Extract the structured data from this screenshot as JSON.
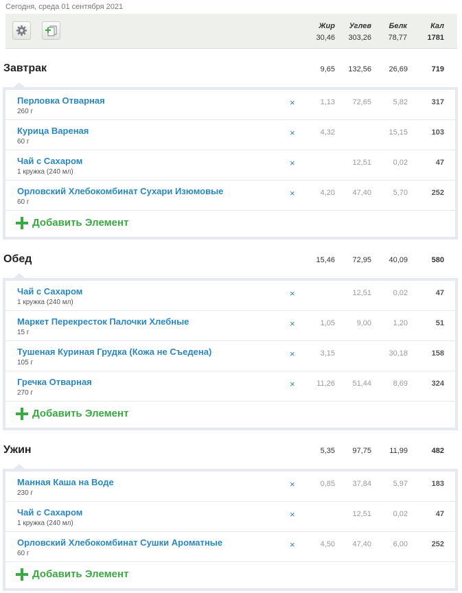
{
  "date_text": "Сегодня, среда 01 сентября 2021",
  "toolbar": {
    "settings_icon": "gear-icon",
    "add_copy_icon": "add-copy-icon"
  },
  "totals": {
    "fat_label": "Жир",
    "carbs_label": "Углев",
    "protein_label": "Белк",
    "cal_label": "Кал",
    "fat": "30,46",
    "carbs": "303,26",
    "protein": "78,77",
    "cal": "1781"
  },
  "add_label": "Добавить Элемент",
  "delete_glyph": "×",
  "meals": [
    {
      "name": "Завтрак",
      "fat": "9,65",
      "carbs": "132,56",
      "protein": "26,69",
      "cal": "719",
      "items": [
        {
          "name": "Перловка Отварная",
          "qty": "260 г",
          "fat": "1,13",
          "carbs": "72,65",
          "protein": "5,82",
          "cal": "317"
        },
        {
          "name": "Курица Вареная",
          "qty": "60 г",
          "fat": "4,32",
          "carbs": "",
          "protein": "15,15",
          "cal": "103"
        },
        {
          "name": "Чай с Сахаром",
          "qty": "1 кружка (240 мл)",
          "fat": "",
          "carbs": "12,51",
          "protein": "0,02",
          "cal": "47"
        },
        {
          "name": "Орловский Хлебокомбинат Сухари Изюмовые",
          "qty": "60 г",
          "fat": "4,20",
          "carbs": "47,40",
          "protein": "5,70",
          "cal": "252"
        }
      ]
    },
    {
      "name": "Обед",
      "fat": "15,46",
      "carbs": "72,95",
      "protein": "40,09",
      "cal": "580",
      "items": [
        {
          "name": "Чай с Сахаром",
          "qty": "1 кружка (240 мл)",
          "fat": "",
          "carbs": "12,51",
          "protein": "0,02",
          "cal": "47"
        },
        {
          "name": "Маркет Перекресток Палочки Хлебные",
          "qty": "15 г",
          "fat": "1,05",
          "carbs": "9,00",
          "protein": "1,20",
          "cal": "51"
        },
        {
          "name": "Тушеная Куриная Грудка (Кожа не Съедена)",
          "qty": "105 г",
          "fat": "3,15",
          "carbs": "",
          "protein": "30,18",
          "cal": "158"
        },
        {
          "name": "Гречка Отварная",
          "qty": "270 г",
          "fat": "11,26",
          "carbs": "51,44",
          "protein": "8,69",
          "cal": "324"
        }
      ]
    },
    {
      "name": "Ужин",
      "fat": "5,35",
      "carbs": "97,75",
      "protein": "11,99",
      "cal": "482",
      "items": [
        {
          "name": "Манная Каша на Воде",
          "qty": "230 г",
          "fat": "0,85",
          "carbs": "37,84",
          "protein": "5,97",
          "cal": "183"
        },
        {
          "name": "Чай с Сахаром",
          "qty": "1 кружка (240 мл)",
          "fat": "",
          "carbs": "12,51",
          "protein": "0,02",
          "cal": "47"
        },
        {
          "name": "Орловский Хлебокомбинат Сушки Ароматные",
          "qty": "60 г",
          "fat": "4,50",
          "carbs": "47,40",
          "protein": "6,00",
          "cal": "252"
        }
      ]
    }
  ]
}
